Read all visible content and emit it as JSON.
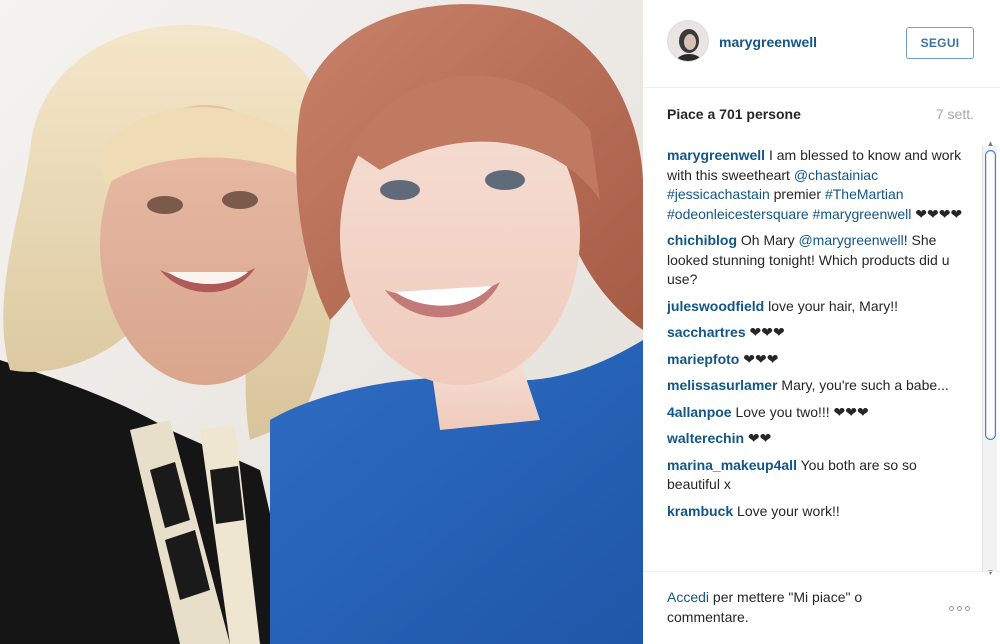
{
  "post": {
    "username": "marygreenwell",
    "follow_label": "SEGUI",
    "likes_text": "Piace a 701 persone",
    "time_ago": "7 sett."
  },
  "comments": [
    {
      "user": "marygreenwell",
      "segments": [
        {
          "kind": "text",
          "value": " I am blessed to know and work with this sweetheart "
        },
        {
          "kind": "tag",
          "value": "@chastainiac"
        },
        {
          "kind": "text",
          "value": " "
        },
        {
          "kind": "tag",
          "value": "#jessicachastain"
        },
        {
          "kind": "text",
          "value": " premier "
        },
        {
          "kind": "tag",
          "value": "#TheMartian"
        },
        {
          "kind": "text",
          "value": " "
        },
        {
          "kind": "tag",
          "value": "#odeonleicestersquare"
        },
        {
          "kind": "text",
          "value": " "
        },
        {
          "kind": "tag",
          "value": "#marygreenwell"
        },
        {
          "kind": "text",
          "value": " ❤❤❤❤"
        }
      ]
    },
    {
      "user": "chichiblog",
      "segments": [
        {
          "kind": "text",
          "value": " Oh Mary "
        },
        {
          "kind": "tag",
          "value": "@marygreenwell"
        },
        {
          "kind": "text",
          "value": "! She looked stunning tonight! Which products did u use?"
        }
      ]
    },
    {
      "user": "juleswoodfield",
      "segments": [
        {
          "kind": "text",
          "value": " love your hair, Mary!!"
        }
      ]
    },
    {
      "user": "sacchartres",
      "segments": [
        {
          "kind": "text",
          "value": " ❤❤❤"
        }
      ]
    },
    {
      "user": "mariepfoto",
      "segments": [
        {
          "kind": "text",
          "value": " ❤❤❤"
        }
      ]
    },
    {
      "user": "melissasurlamer",
      "segments": [
        {
          "kind": "text",
          "value": " Mary, you're such a babe..."
        }
      ]
    },
    {
      "user": "4allanpoe",
      "segments": [
        {
          "kind": "text",
          "value": " Love you two!!! ❤❤❤"
        }
      ]
    },
    {
      "user": "walterechin",
      "segments": [
        {
          "kind": "text",
          "value": " ❤❤"
        }
      ]
    },
    {
      "user": "marina_makeup4all",
      "segments": [
        {
          "kind": "text",
          "value": " You both are so so beautiful x"
        }
      ]
    },
    {
      "user": "krambuck",
      "segments": [
        {
          "kind": "text",
          "value": " Love your work!!"
        }
      ]
    }
  ],
  "footer": {
    "login_link": "Accedi",
    "login_rest": " per mettere \"Mi piace\" o commentare."
  },
  "colors": {
    "link": "#125688",
    "follow_border": "#6fa0c7",
    "muted": "#a5a7aa",
    "dress_blue": "#2f6fc2"
  }
}
